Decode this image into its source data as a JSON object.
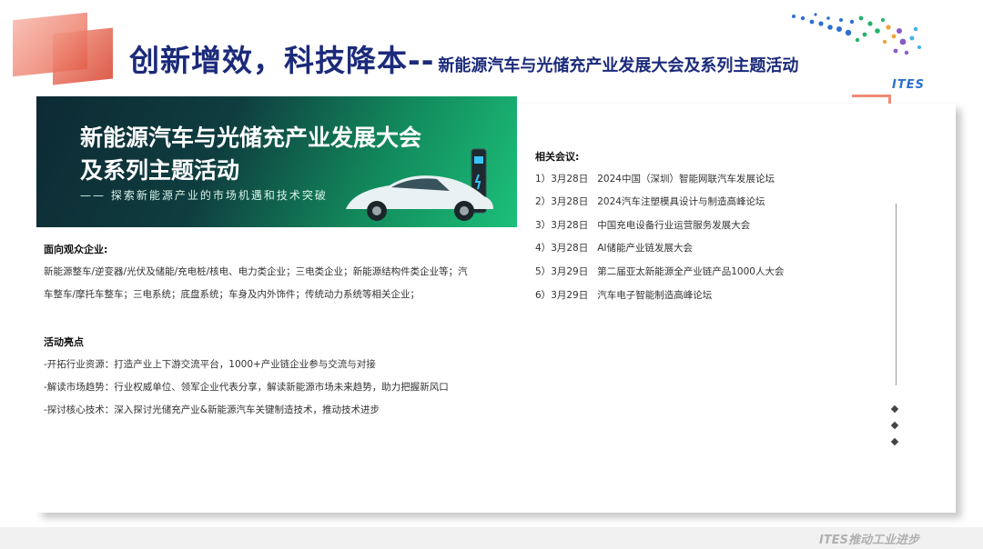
{
  "header": {
    "title_main": "创新增效，科技降本--",
    "title_sub": "新能源汽车与光储充产业发展大会及系列主题活动",
    "logo_text": "ITES"
  },
  "banner": {
    "line1": "新能源汽车与光储充产业发展大会",
    "line2": "及系列主题活动",
    "subtitle": "—— 探索新能源产业的市场机遇和技术突破"
  },
  "audience": {
    "heading": "面向观众企业:",
    "lines": [
      "新能源整车/逆变器/光伏及储能/充电桩/核电、电力类企业；三电类企业；新能源结构件类企业等；汽",
      "车整车/摩托车整车；三电系统；底盘系统；车身及内外饰件；传统动力系统等相关企业；"
    ]
  },
  "highlights": {
    "heading": "活动亮点",
    "lines": [
      "-开拓行业资源：打造产业上下游交流平台，1000+产业链企业参与交流与对接",
      "-解读市场趋势：行业权威单位、领军企业代表分享，解读新能源市场未来趋势，助力把握新风口",
      "-探讨核心技术：深入探讨光储充产业&新能源汽车关键制造技术，推动技术进步"
    ]
  },
  "meetings": {
    "heading": "相关会议:",
    "items": [
      {
        "no": "1）",
        "date": "3月28日",
        "name": "2024中国（深圳）智能网联汽车发展论坛"
      },
      {
        "no": "2）",
        "date": "3月28日",
        "name": "2024汽车注塑模具设计与制造高峰论坛"
      },
      {
        "no": "3）",
        "date": "3月28日",
        "name": "中国充电设备行业运营服务发展大会"
      },
      {
        "no": "4）",
        "date": "3月28日",
        "name": "AI储能产业链发展大会"
      },
      {
        "no": "5）",
        "date": "3月29日",
        "name": "第二届亚太新能源全产业链产品1000人大会"
      },
      {
        "no": "6）",
        "date": "3月29日",
        "name": "汽车电子智能制造高峰论坛"
      }
    ]
  },
  "footer": {
    "slogan": "ITES推动工业进步"
  }
}
